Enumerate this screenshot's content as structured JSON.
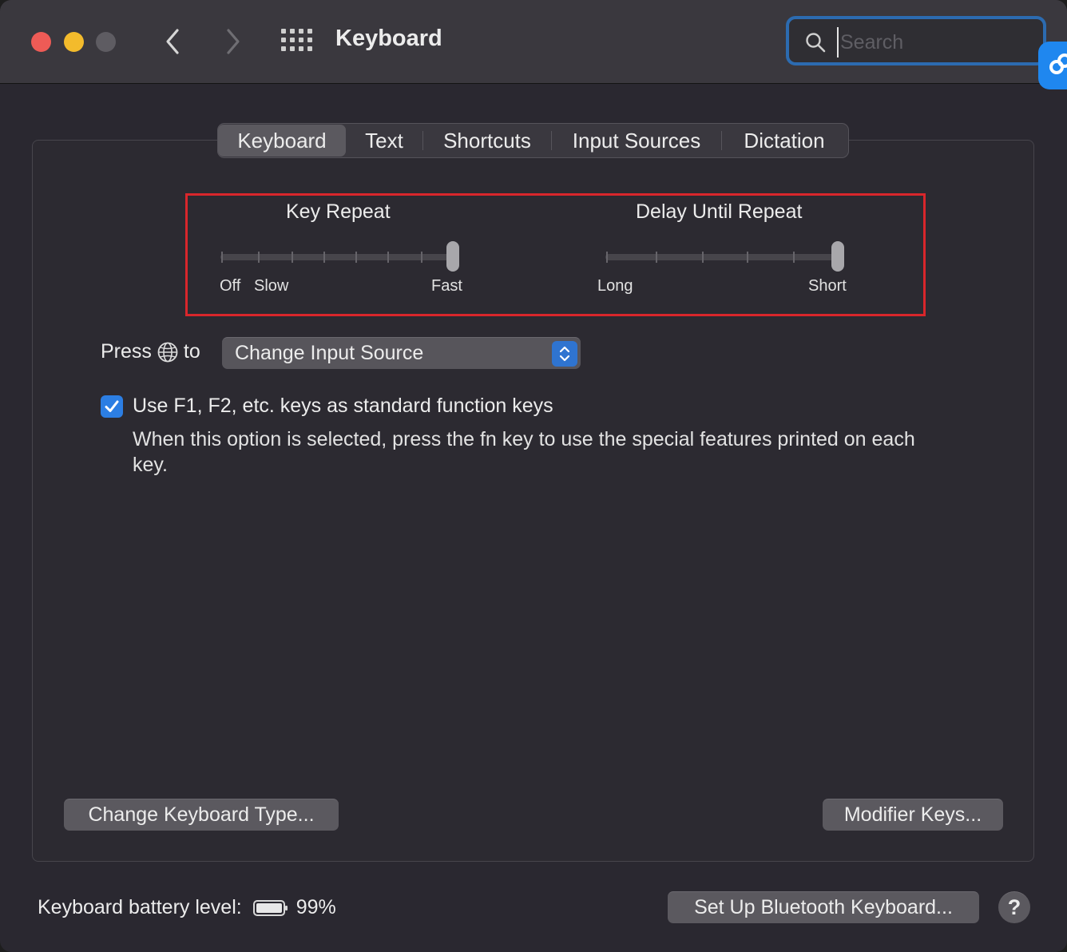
{
  "window": {
    "title": "Keyboard"
  },
  "search": {
    "placeholder": "Search",
    "value": ""
  },
  "tabs": [
    {
      "label": "Keyboard",
      "active": true
    },
    {
      "label": "Text",
      "active": false
    },
    {
      "label": "Shortcuts",
      "active": false
    },
    {
      "label": "Input Sources",
      "active": false
    },
    {
      "label": "Dictation",
      "active": false
    }
  ],
  "key_repeat": {
    "title": "Key Repeat",
    "label_off": "Off",
    "label_slow": "Slow",
    "label_fast": "Fast",
    "value_fraction": 1.0
  },
  "delay_until_repeat": {
    "title": "Delay Until Repeat",
    "label_long": "Long",
    "label_short": "Short",
    "value_fraction": 1.0
  },
  "press_globe": {
    "press_label": "Press",
    "to_label": "to",
    "selected": "Change Input Source"
  },
  "fn_keys": {
    "checked": true,
    "label": "Use F1, F2, etc. keys as standard function keys",
    "description": "When this option is selected, press the fn key to use the special features printed on each key."
  },
  "buttons": {
    "change_keyboard_type": "Change Keyboard Type...",
    "modifier_keys": "Modifier Keys...",
    "setup_bluetooth": "Set Up Bluetooth Keyboard...",
    "help": "?"
  },
  "battery": {
    "label": "Keyboard battery level:",
    "percent_text": "99%",
    "level": 0.99
  },
  "colors": {
    "accent": "#2c7ee3",
    "highlight_box": "#d9262b",
    "close": "#ee5b56",
    "minimize": "#f3bb2c",
    "zoom_inactive": "#5e5c62"
  }
}
